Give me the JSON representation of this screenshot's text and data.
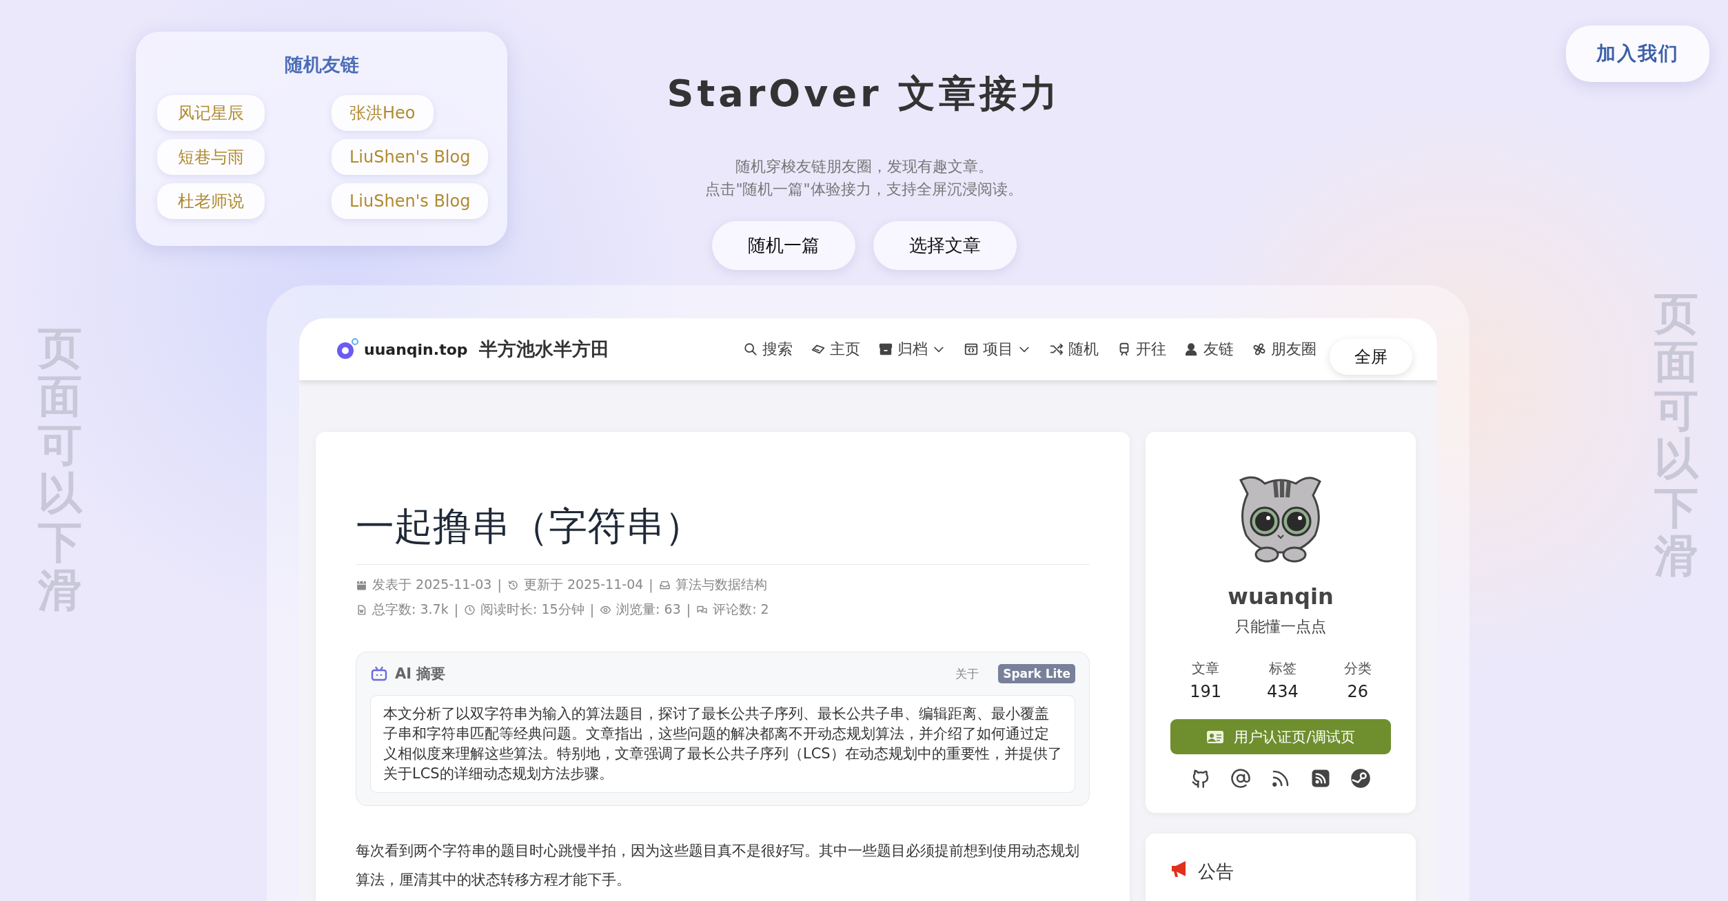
{
  "friend_links": {
    "title": "随机友链",
    "items": [
      "风记星辰",
      "张洪Heo",
      "短巷与雨",
      "LiuShen's Blog",
      "杜老师说",
      "LiuShen's Blog"
    ]
  },
  "hero": {
    "title": "StarOver 文章接力",
    "lines": [
      "随机穿梭友链朋友圈，发现有趣文章。",
      "点击\"随机一篇\"体验接力，支持全屏沉浸阅读。"
    ],
    "buttons": [
      "随机一篇",
      "选择文章"
    ]
  },
  "join_button": "加入我们",
  "side_hints": [
    "页面可以下滑",
    "页面可以下滑"
  ],
  "site": {
    "logo": "uuanqin.top",
    "name": "半方池水半方田",
    "nav": [
      {
        "kind": "search",
        "label": "搜索",
        "has_menu": false
      },
      {
        "kind": "home",
        "label": "主页",
        "has_menu": false
      },
      {
        "kind": "archive",
        "label": "归档",
        "has_menu": true
      },
      {
        "kind": "project",
        "label": "项目",
        "has_menu": true
      },
      {
        "kind": "shuffle",
        "label": "随机",
        "has_menu": false
      },
      {
        "kind": "train",
        "label": "开往",
        "has_menu": false
      },
      {
        "kind": "user",
        "label": "友链",
        "has_menu": false
      },
      {
        "kind": "fan",
        "label": "朋友圈",
        "has_menu": false
      }
    ],
    "fullscreen_button": "全屏"
  },
  "article": {
    "title": "一起撸串（字符串）",
    "separator": "|",
    "meta": [
      [
        {
          "kind": "calendar",
          "text": "发表于 2025-11-03"
        },
        {
          "kind": "history",
          "text": "更新于 2025-11-04"
        },
        {
          "kind": "inbox",
          "text": "算法与数据结构"
        }
      ],
      [
        {
          "kind": "file",
          "text": "总字数: 3.7k"
        },
        {
          "kind": "clock",
          "text": "阅读时长: 15分钟"
        },
        {
          "kind": "eye",
          "text": "浏览量: 63"
        },
        {
          "kind": "comments",
          "text": "评论数: 2"
        }
      ]
    ],
    "ai_summary": {
      "title": "AI 摘要",
      "about": "关于",
      "model": "Spark Lite",
      "text": "本文分析了以双字符串为输入的算法题目，探讨了最长公共子序列、最长公共子串、编辑距离、最小覆盖子串和字符串匹配等经典问题。文章指出，这些问题的解决都离不开动态规划算法，并介绍了如何通过定义相似度来理解这些算法。特别地，文章强调了最长公共子序列（LCS）在动态规划中的重要性，并提供了关于LCS的详细动态规划方法步骤。"
    },
    "paragraph": "每次看到两个字符串的题目时心跳慢半拍，因为这些题目真不是很好写。其中一些题目必须提前想到使用动态规划算法，厘清其中的状态转移方程才能下手。"
  },
  "profile": {
    "name": "wuanqin",
    "bio": "只能懂一点点",
    "stats": [
      {
        "label": "文章",
        "value": "191"
      },
      {
        "label": "标签",
        "value": "434"
      },
      {
        "label": "分类",
        "value": "26"
      }
    ],
    "button": "用户认证页/调试页"
  },
  "announcement": {
    "title": "公告"
  }
}
